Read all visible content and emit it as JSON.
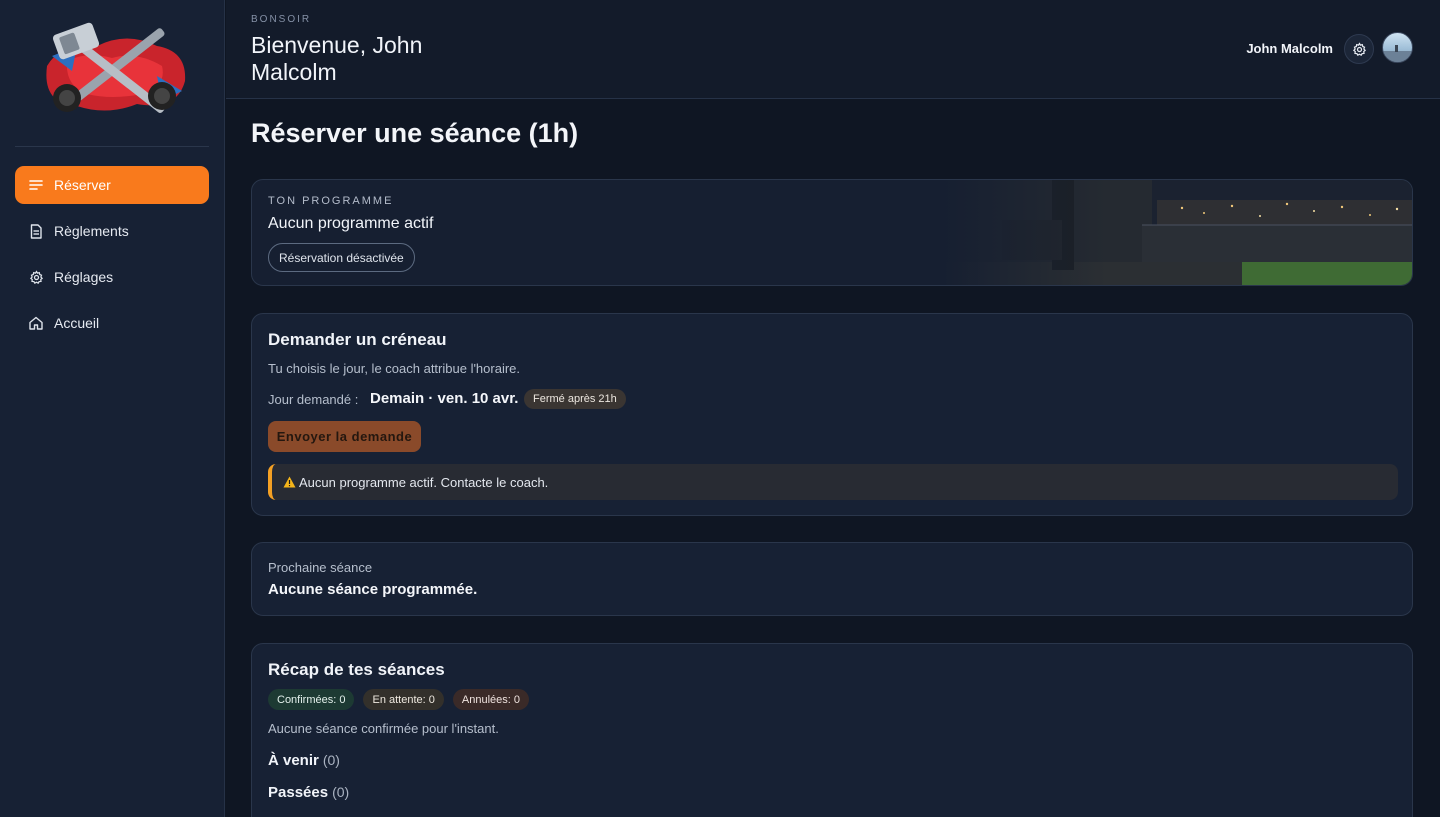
{
  "sidebar": {
    "items": [
      {
        "label": "Réserver",
        "icon": "menu-lines-icon",
        "active": true
      },
      {
        "label": "Règlements",
        "icon": "document-icon",
        "active": false
      },
      {
        "label": "Réglages",
        "icon": "gear-icon",
        "active": false
      },
      {
        "label": "Accueil",
        "icon": "home-icon",
        "active": false
      }
    ]
  },
  "header": {
    "greeting_small": "BONSOIR",
    "greeting_title": "Bienvenue, John Malcolm",
    "user_name": "John Malcolm"
  },
  "main": {
    "title": "Réserver une séance (1h)",
    "program": {
      "label": "TON PROGRAMME",
      "value": "Aucun programme actif",
      "chip": "Réservation désactivée"
    },
    "request": {
      "title": "Demander un créneau",
      "subtitle": "Tu choisis le jour, le coach attribue l'horaire.",
      "day_label": "Jour demandé :",
      "day_value": "Demain · ven. 10 avr.",
      "closed_badge": "Fermé après 21h",
      "send_button": "Envoyer la demande",
      "warning": "Aucun programme actif. Contacte le coach."
    },
    "next_session": {
      "label": "Prochaine séance",
      "value": "Aucune séance programmée."
    },
    "recap": {
      "title": "Récap de tes séances",
      "badges": {
        "confirmed": "Confirmées: 0",
        "pending": "En attente: 0",
        "cancelled": "Annulées: 0"
      },
      "empty_text": "Aucune séance confirmée pour l'instant.",
      "upcoming_label": "À venir",
      "upcoming_count": "(0)",
      "past_label": "Passées",
      "past_count": "(0)"
    }
  },
  "colors": {
    "accent": "#f97a1c",
    "background": "#0f1623",
    "sidebar": "#172134",
    "card": "#172134",
    "warning": "#f4a024"
  }
}
